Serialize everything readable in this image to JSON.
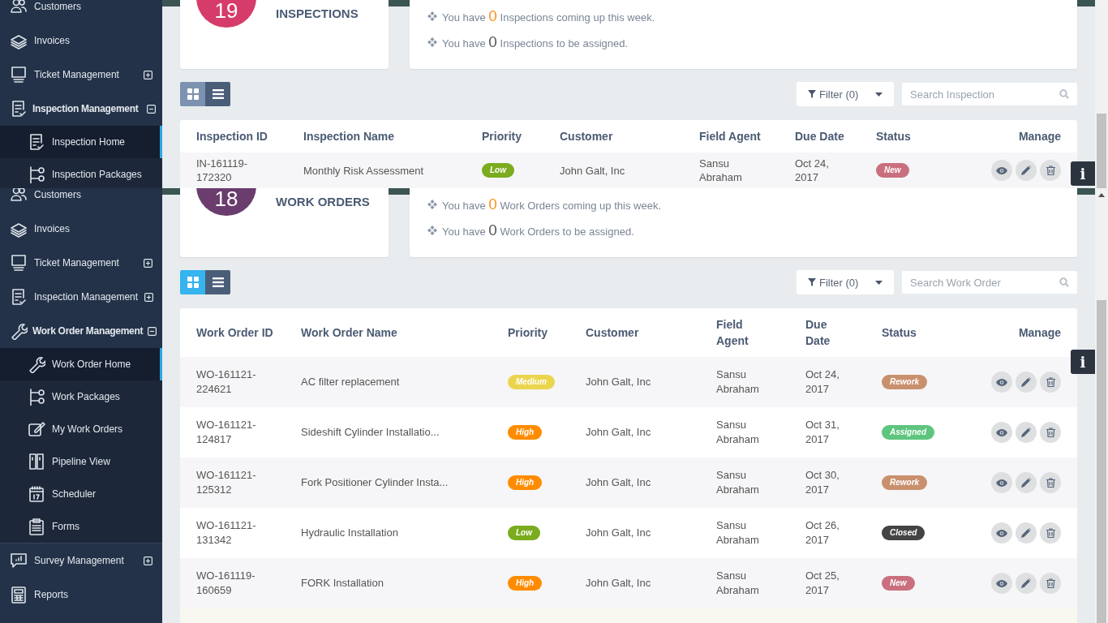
{
  "screens": [
    {
      "sidebar": {
        "items": [
          {
            "kind": "customers",
            "label": "Customers"
          },
          {
            "kind": "invoices",
            "label": "Invoices"
          },
          {
            "kind": "tickets",
            "label": "Ticket Management",
            "expanded": false
          },
          {
            "kind": "inspection",
            "label": "Inspection Management",
            "expanded": true,
            "children": [
              {
                "kind": "inspection",
                "label": "Inspection Home",
                "selected": true
              },
              {
                "kind": "packages",
                "label": "Inspection Packages",
                "selected": false
              }
            ]
          }
        ]
      },
      "summary": {
        "count": "19",
        "color": "#d63c6a",
        "title": "INSPECTIONS",
        "lines": [
          {
            "prefix": "You have",
            "number": "0",
            "suffix": "Inspections coming up this week.",
            "color": "#f7941d"
          },
          {
            "prefix": "You have",
            "number": "0",
            "suffix": "Inspections to be assigned.",
            "color": "#555555"
          }
        ]
      },
      "toolbar": {
        "view_buttons": [
          {
            "kind": "grid",
            "color": "#7b93b0"
          },
          {
            "kind": "list",
            "color": "#4a5e78"
          }
        ],
        "filter": "Filter (0)",
        "search": {
          "placeholder": "Search Inspection"
        }
      },
      "table": {
        "columns": [
          "Inspection ID",
          "Inspection Name",
          "Priority",
          "Customer",
          "Field Agent",
          "Due Date",
          "Status",
          "Manage"
        ],
        "rows": [
          {
            "id": "IN-161119-172320",
            "name": "Monthly Risk Assessment",
            "priority": {
              "label": "Low",
              "color": "#7aac1e"
            },
            "customer": "John Galt, Inc",
            "agent": "Sansu Abraham",
            "due": "Oct 24, 2017",
            "status": {
              "label": "New",
              "color": "#c96f7e"
            }
          }
        ]
      },
      "info_button": "i"
    },
    {
      "sidebar": {
        "items": [
          {
            "kind": "customers",
            "label": "Customers"
          },
          {
            "kind": "invoices",
            "label": "Invoices"
          },
          {
            "kind": "tickets",
            "label": "Ticket Management",
            "expanded": false
          },
          {
            "kind": "inspection",
            "label": "Inspection Management",
            "expanded": false
          },
          {
            "kind": "workorder",
            "label": "Work Order Management",
            "expanded": true,
            "children": [
              {
                "kind": "workorder",
                "label": "Work Order Home",
                "selected": true
              },
              {
                "kind": "packages",
                "label": "Work Packages",
                "selected": false
              },
              {
                "kind": "edit",
                "label": "My Work Orders",
                "selected": false
              },
              {
                "kind": "pipeline",
                "label": "Pipeline View",
                "selected": false
              },
              {
                "kind": "scheduler",
                "label": "Scheduler",
                "selected": false
              },
              {
                "kind": "forms",
                "label": "Forms",
                "selected": false
              }
            ]
          },
          {
            "kind": "survey",
            "label": "Survey Management",
            "expanded": false
          },
          {
            "kind": "reports",
            "label": "Reports"
          }
        ]
      },
      "summary": {
        "count": "18",
        "color": "#6a3d6e",
        "title": "WORK ORDERS",
        "lines": [
          {
            "prefix": "You have",
            "number": "0",
            "suffix": "Work Orders coming up this week.",
            "color": "#f7941d"
          },
          {
            "prefix": "You have",
            "number": "0",
            "suffix": "Work Orders to be assigned.",
            "color": "#555555"
          }
        ]
      },
      "toolbar": {
        "view_buttons": [
          {
            "kind": "grid",
            "color": "#35b4f0"
          },
          {
            "kind": "list",
            "color": "#4a5e78"
          }
        ],
        "filter": "Filter (0)",
        "search": {
          "placeholder": "Search Work Order"
        }
      },
      "table": {
        "columns": [
          "Work Order ID",
          "Work Order Name",
          "Priority",
          "Customer",
          "Field Agent",
          "Due Date",
          "Status",
          "Manage"
        ],
        "rows": [
          {
            "id": "WO-161121-224621",
            "name": "AC filter replacement",
            "priority": {
              "label": "Medium",
              "color": "#ecd54e"
            },
            "customer": "John Galt, Inc",
            "agent": "Sansu Abraham",
            "due": "Oct 24, 2017",
            "status": {
              "label": "Rework",
              "color": "#c9906e"
            }
          },
          {
            "id": "WO-161121-124817",
            "name": "Sideshift Cylinder Installatio...",
            "priority": {
              "label": "High",
              "color": "#ff8c00"
            },
            "customer": "John Galt, Inc",
            "agent": "Sansu Abraham",
            "due": "Oct 31, 2017",
            "status": {
              "label": "Assigned",
              "color": "#5ec57e"
            }
          },
          {
            "id": "WO-161121-125312",
            "name": "Fork Positioner Cylinder Insta...",
            "priority": {
              "label": "High",
              "color": "#ff8c00"
            },
            "customer": "John Galt, Inc",
            "agent": "Sansu Abraham",
            "due": "Oct 30, 2017",
            "status": {
              "label": "Rework",
              "color": "#c9906e"
            }
          },
          {
            "id": "WO-161121-131342",
            "name": "Hydraulic Installation",
            "priority": {
              "label": "Low",
              "color": "#7aac1e"
            },
            "customer": "John Galt, Inc",
            "agent": "Sansu Abraham",
            "due": "Oct 26, 2017",
            "status": {
              "label": "Closed",
              "color": "#444444"
            }
          },
          {
            "id": "WO-161119-160659",
            "name": "FORK Installation",
            "priority": {
              "label": "High",
              "color": "#ff8c00"
            },
            "customer": "John Galt, Inc",
            "agent": "Sansu Abraham",
            "due": "Oct 25, 2017",
            "status": {
              "label": "New",
              "color": "#c96f7e"
            }
          }
        ]
      },
      "info_button": "i"
    }
  ]
}
